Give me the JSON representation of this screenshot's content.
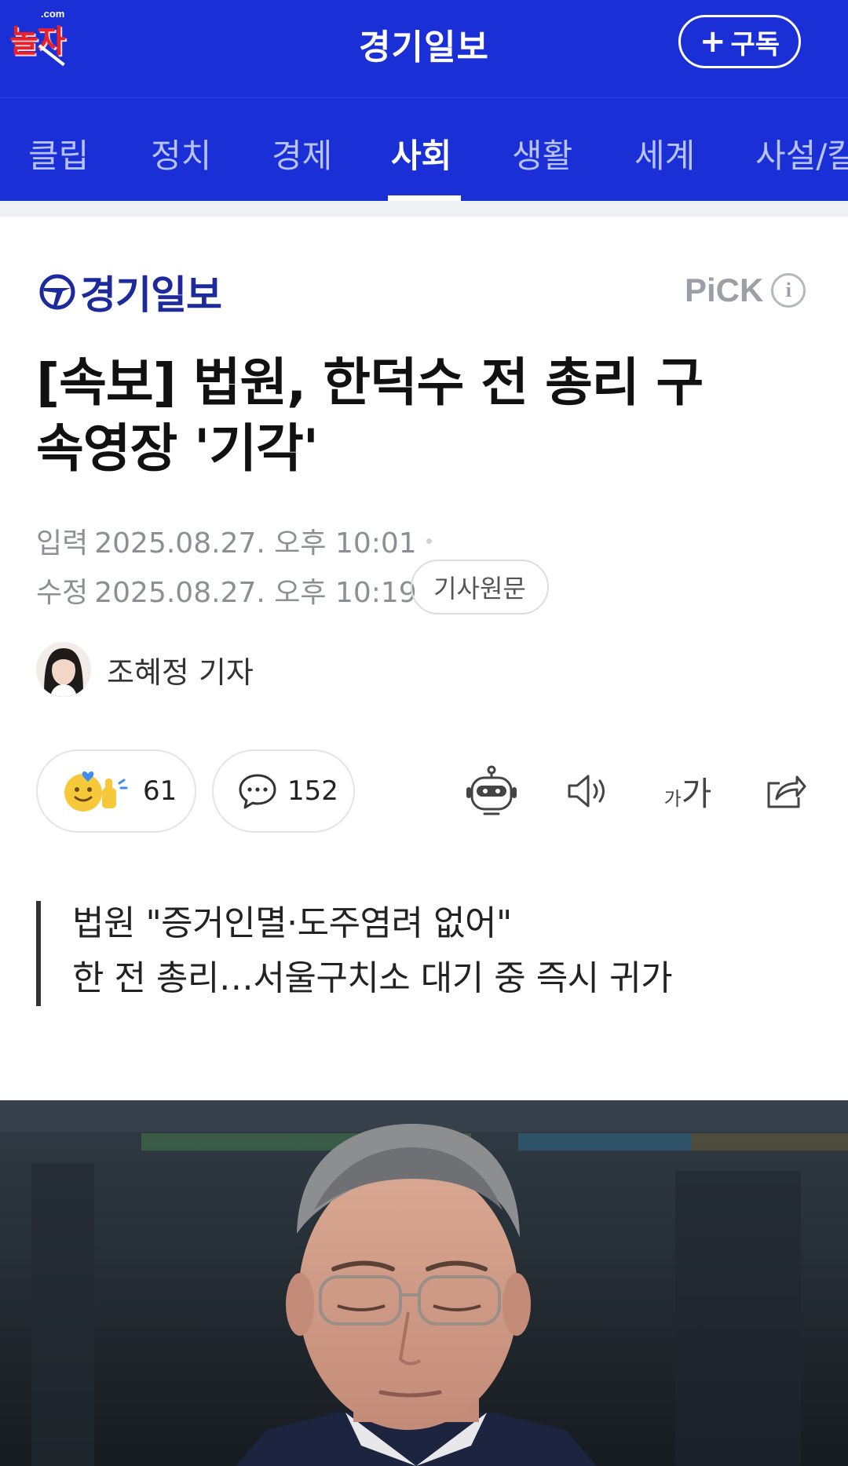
{
  "header": {
    "watermark_top": ".com",
    "watermark_text": "놀자",
    "title": "경기일보",
    "subscribe_plus": "+",
    "subscribe_label": "구독"
  },
  "tabs": [
    {
      "label": "클립"
    },
    {
      "label": "정치"
    },
    {
      "label": "경제"
    },
    {
      "label": "사회",
      "active": true
    },
    {
      "label": "생활"
    },
    {
      "label": "세계"
    },
    {
      "label": "사설/칼"
    }
  ],
  "article": {
    "press_name": "경기일보",
    "pick_label": "PiCK",
    "pick_info": "i",
    "headline_line1": "[속보] 법원, 한덕수 전 총리 구",
    "headline_line2": "속영장 '기각'",
    "input_label": "입력",
    "input_time": "2025.08.27. 오후 10:01",
    "modified_label": "수정",
    "modified_time": "2025.08.27. 오후 10:19",
    "original_link": "기사원문",
    "reporter": "조혜정 기자",
    "reaction_count": "61",
    "comment_count": "152",
    "font_size_small": "가",
    "font_size_large": "가",
    "summary_line1": "법원 \"증거인멸·도주염려 없어\"",
    "summary_line2": "한 전 총리…서울구치소 대기 중 즉시 귀가"
  },
  "colors": {
    "header_bg": "#1a2fd6",
    "tab_inactive": "#b7c2ff",
    "press_logo": "#1d2a9c",
    "meta_text": "#8c8f94"
  }
}
